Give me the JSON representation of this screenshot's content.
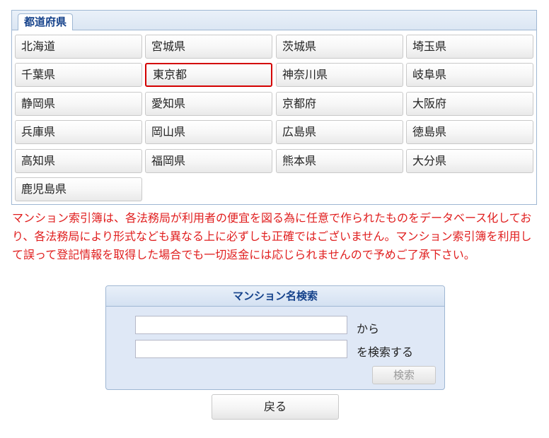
{
  "prefecture_panel": {
    "tab_label": "都道府県",
    "selected": "東京都",
    "rows": [
      [
        "北海道",
        "宮城県",
        "茨城県",
        "埼玉県"
      ],
      [
        "千葉県",
        "東京都",
        "神奈川県",
        "岐阜県"
      ],
      [
        "静岡県",
        "愛知県",
        "京都府",
        "大阪府"
      ],
      [
        "兵庫県",
        "岡山県",
        "広島県",
        "徳島県"
      ],
      [
        "高知県",
        "福岡県",
        "熊本県",
        "大分県"
      ],
      [
        "鹿児島県"
      ]
    ]
  },
  "notice": "マンション索引簿は、各法務局が利用者の便宜を図る為に任意で作られたものをデータベース化しており、各法務局により形式なども異なる上に必ずしも正確ではございません。マンション索引簿を利用して誤って登記情報を取得した場合でも一切返金には応じられませんので予めご了承下さい。",
  "search_panel": {
    "title": "マンション名検索",
    "input1_value": "",
    "input1_suffix": "から",
    "input2_value": "",
    "input2_suffix": "を検索する",
    "search_button": "検索"
  },
  "back_button": "戻る"
}
